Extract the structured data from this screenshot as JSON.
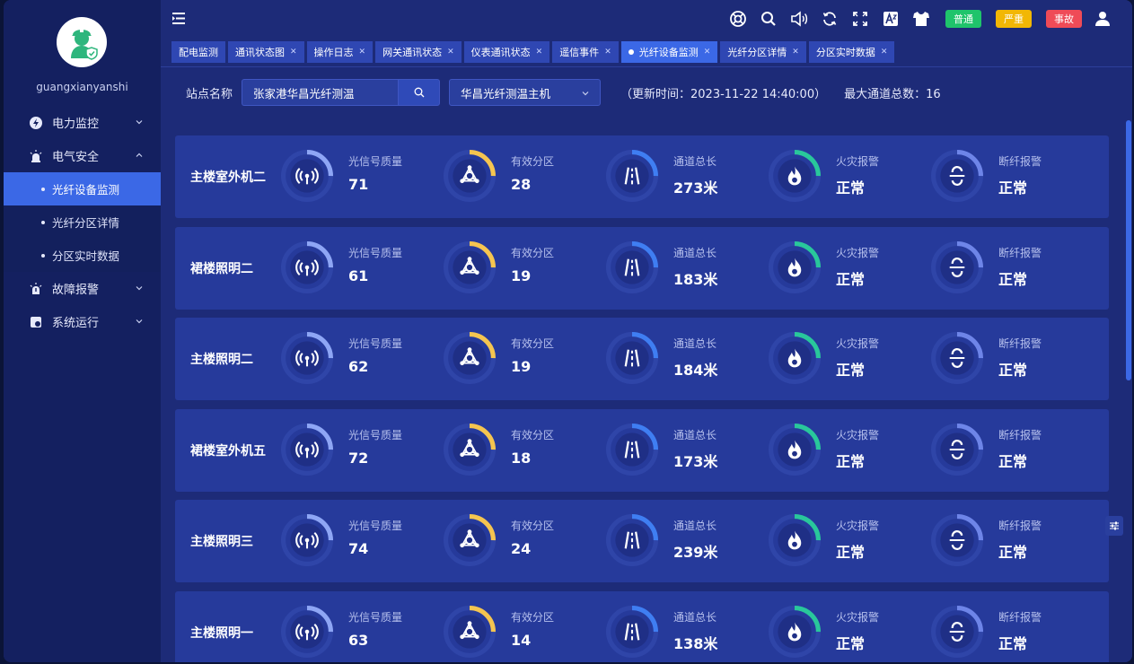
{
  "user": {
    "name": "guangxianyanshi"
  },
  "sidebar": {
    "items": [
      {
        "label": "电力监控",
        "icon": "power-icon",
        "expanded": false
      },
      {
        "label": "电气安全",
        "icon": "alarm-icon",
        "expanded": true,
        "children": [
          {
            "label": "光纤设备监测",
            "active": true
          },
          {
            "label": "光纤分区详情",
            "active": false
          },
          {
            "label": "分区实时数据",
            "active": false
          }
        ]
      },
      {
        "label": "故障报警",
        "icon": "fault-icon",
        "expanded": false
      },
      {
        "label": "系统运行",
        "icon": "system-icon",
        "expanded": false
      }
    ]
  },
  "toolbar": {
    "icons": [
      "help-icon",
      "search-icon",
      "volume-icon",
      "refresh-icon",
      "fullscreen-icon",
      "font-size-icon",
      "theme-icon",
      "user-icon"
    ],
    "badges": {
      "normal": "普通",
      "serious": "严重",
      "accident": "事故"
    }
  },
  "tabs": [
    {
      "label": "配电监测",
      "closable": false,
      "active": false
    },
    {
      "label": "通讯状态图",
      "closable": true,
      "active": false
    },
    {
      "label": "操作日志",
      "closable": true,
      "active": false
    },
    {
      "label": "网关通讯状态",
      "closable": true,
      "active": false
    },
    {
      "label": "仪表通讯状态",
      "closable": true,
      "active": false
    },
    {
      "label": "遥信事件",
      "closable": true,
      "active": false
    },
    {
      "label": "光纤设备监测",
      "closable": true,
      "active": true
    },
    {
      "label": "光纤分区详情",
      "closable": true,
      "active": false
    },
    {
      "label": "分区实时数据",
      "closable": true,
      "active": false
    }
  ],
  "filter": {
    "station_label": "站点名称",
    "station_value": "张家港华昌光纤测温",
    "host_value": "华昌光纤测温主机",
    "update_text": "（更新时间：2023-11-22 14:40:00）",
    "max_channels_text": "最大通道总数：16"
  },
  "metric_labels": {
    "signal": "光信号质量",
    "zones": "有效分区",
    "length": "通道总长",
    "fire": "火灾报警",
    "break": "断纤报警"
  },
  "colors": {
    "signal": "#8ea6f5",
    "zones": "#f5c550",
    "length": "#3f7ef2",
    "fire": "#29c79b",
    "break": "#6e85e8",
    "track": "#2f45a8",
    "inner": "#1f2f86"
  },
  "devices": [
    {
      "name": "主楼室外机二",
      "signal": "71",
      "zones": "28",
      "length": "273米",
      "fire": "正常",
      "break": "正常"
    },
    {
      "name": "裙楼照明二",
      "signal": "61",
      "zones": "19",
      "length": "183米",
      "fire": "正常",
      "break": "正常"
    },
    {
      "name": "主楼照明二",
      "signal": "62",
      "zones": "19",
      "length": "184米",
      "fire": "正常",
      "break": "正常"
    },
    {
      "name": "裙楼室外机五",
      "signal": "72",
      "zones": "18",
      "length": "173米",
      "fire": "正常",
      "break": "正常"
    },
    {
      "name": "主楼照明三",
      "signal": "74",
      "zones": "24",
      "length": "239米",
      "fire": "正常",
      "break": "正常"
    },
    {
      "name": "主楼照明一",
      "signal": "63",
      "zones": "14",
      "length": "138米",
      "fire": "正常",
      "break": "正常"
    }
  ]
}
